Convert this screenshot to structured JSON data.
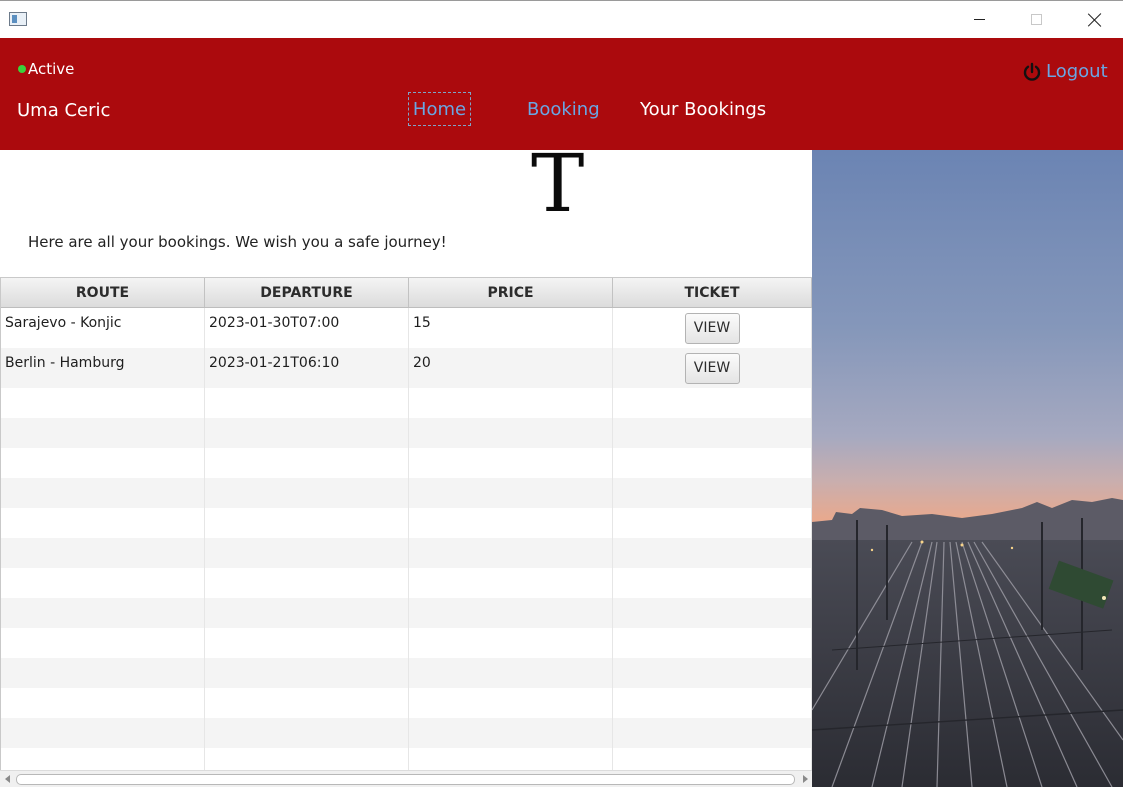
{
  "window": {
    "minimize_icon": "minimize-icon",
    "maximize_icon": "maximize-icon",
    "close_icon": "close-icon"
  },
  "header": {
    "status": "Active",
    "status_color": "#3bd23b",
    "username": "Uma Ceric",
    "nav": {
      "home": "Home",
      "booking": "Booking",
      "your_bookings": "Your Bookings"
    },
    "logout": "Logout",
    "logout_icon": "power-icon",
    "background_color": "#ab0a0d",
    "link_color": "#6aa6e3"
  },
  "main": {
    "logo": "T",
    "subtitle": "Here are all your bookings. We wish you a safe journey!",
    "table": {
      "columns": [
        "ROUTE",
        "DEPARTURE",
        "PRICE",
        "TICKET"
      ],
      "rows": [
        {
          "route": "Sarajevo - Konjic",
          "departure": "2023-01-30T07:00",
          "price": "15",
          "ticket": "VIEW"
        },
        {
          "route": "Berlin - Hamburg",
          "departure": "2023-01-21T06:10",
          "price": "20",
          "ticket": "VIEW"
        }
      ]
    }
  },
  "photo": {
    "subject": "railway-yard-at-sunset"
  }
}
